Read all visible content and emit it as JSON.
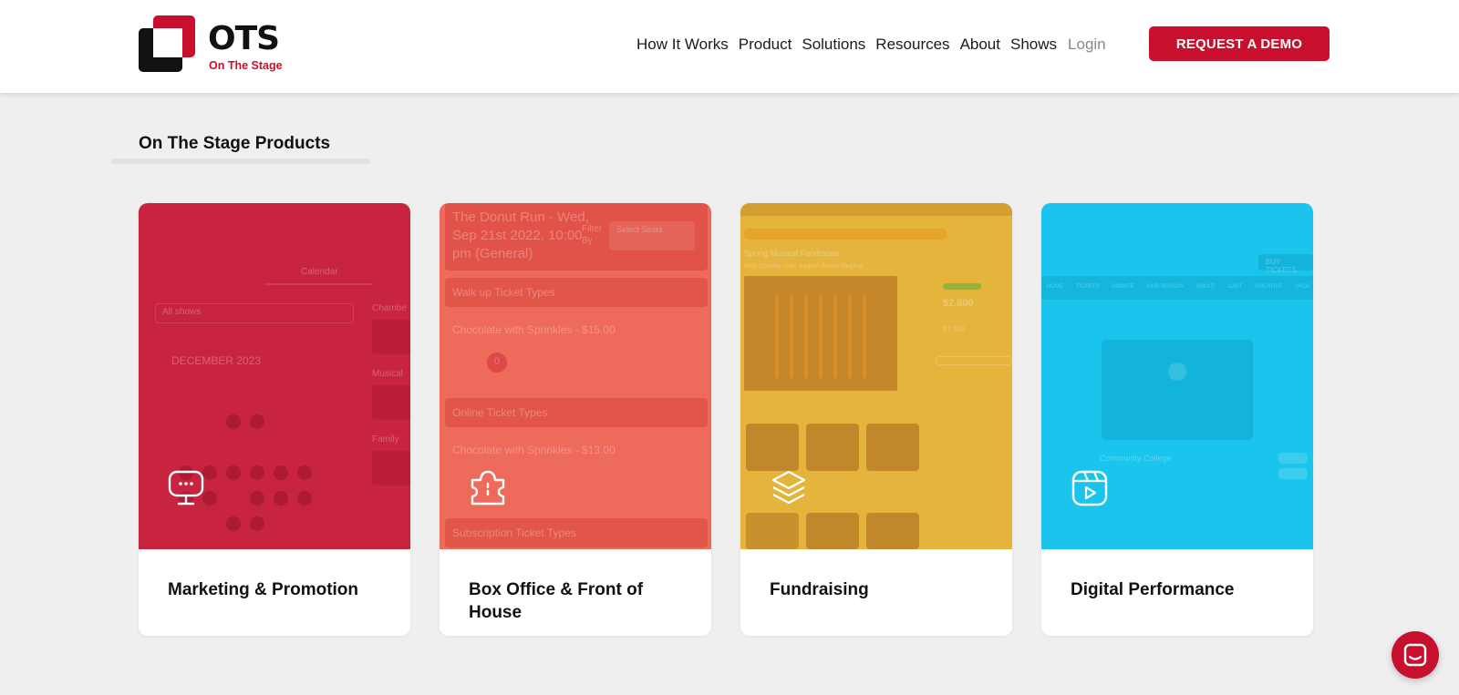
{
  "header": {
    "logo": {
      "name": "OTS",
      "tagline": "On The Stage"
    },
    "nav": [
      {
        "label": "How It Works",
        "muted": false
      },
      {
        "label": "Product",
        "muted": false
      },
      {
        "label": "Solutions",
        "muted": false
      },
      {
        "label": "Resources",
        "muted": false
      },
      {
        "label": "About",
        "muted": false
      },
      {
        "label": "Shows",
        "muted": false
      },
      {
        "label": "Login",
        "muted": true
      }
    ],
    "cta_label": "REQUEST A DEMO"
  },
  "section": {
    "title": "On The Stage Products"
  },
  "cards": [
    {
      "title": "Marketing & Promotion",
      "color": "#c8243f",
      "icon": "presentation-chat-icon",
      "overlay": {
        "tab": "Calendar",
        "select": "All shows",
        "month": "DECEMBER 2023",
        "side_labels": [
          "Chambe",
          "Musical",
          "Family"
        ]
      }
    },
    {
      "title": "Box Office & Front of House",
      "color": "#ee6a5a",
      "icon": "ticket-icon",
      "overlay": {
        "event": "The Donut Run - Wed, Sep 21st 2022, 10:00 pm (General)",
        "filter": "Filter By",
        "filter_select": "Select Seats",
        "group1": "Walk up Ticket Types",
        "item1": "Chocolate with Sprinkles - $15.00",
        "qty": "0",
        "group2": "Online Ticket Types",
        "item2": "Chocolate with Sprinkles - $13.00",
        "group3": "Subscription Ticket Types"
      }
    },
    {
      "title": "Fundraising",
      "color": "#e5b43c",
      "icon": "layers-icon",
      "overlay": {
        "heading": "Spring Musical Fundraiser",
        "subheading": "Help Dorothy Gale support Arena Staging!",
        "raised": "$2,800",
        "goal": "$7,500"
      }
    },
    {
      "title": "Digital Performance",
      "color": "#1bc4ec",
      "icon": "video-play-icon",
      "overlay": {
        "buy": "BUY TICKETS",
        "menu": [
          "HOME",
          "TICKETS",
          "DONATE",
          "OUR SEASON",
          "ABOUT",
          "CAST",
          "CREATIVE",
          "SHOP"
        ],
        "venue": "Community College"
      }
    }
  ],
  "chat": {
    "icon": "chat-icon"
  }
}
